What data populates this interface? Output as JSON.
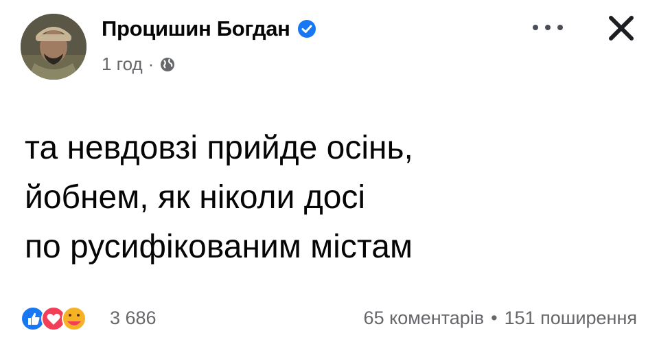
{
  "post": {
    "author_name": "Процишин Богдан",
    "verified": true,
    "time": "1 год",
    "separator": "·",
    "audience_icon": "globe-icon",
    "text_lines": [
      "та невдовзі прийде осінь,",
      "йобнем, як ніколи досі",
      "по русифікованим містам"
    ]
  },
  "footer": {
    "reaction_icons": [
      "like-icon",
      "love-icon",
      "care-icon"
    ],
    "reaction_count": "3 686",
    "comments": "65 коментарів",
    "dot": "•",
    "shares": "151 поширення"
  },
  "colors": {
    "text": "#050505",
    "secondary": "#65676b",
    "verified_blue": "#1877f2",
    "like_blue": "#1877f2",
    "love_red": "#f33e58",
    "care_yellow": "#f7b125"
  }
}
